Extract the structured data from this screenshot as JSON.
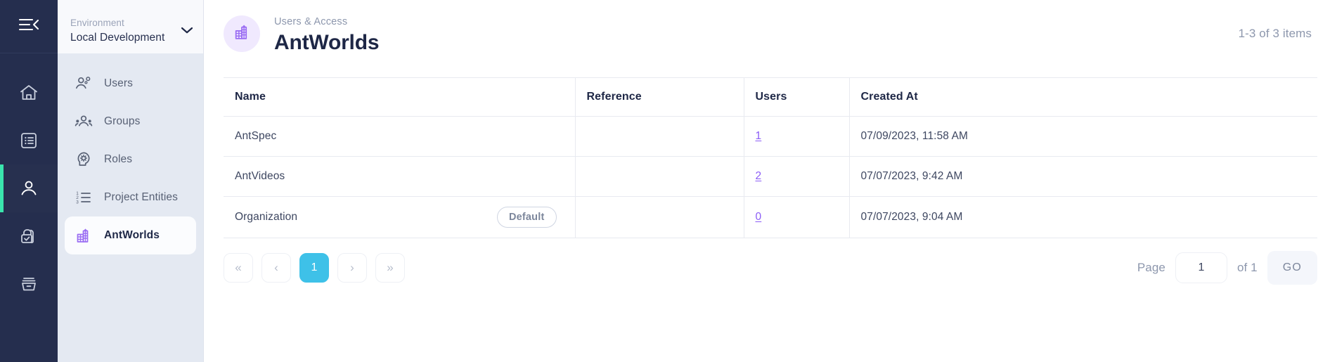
{
  "rail": {
    "collapse_icon": "collapse-menu-icon",
    "items": [
      {
        "icon": "home-icon",
        "name": "home",
        "active": false
      },
      {
        "icon": "list-icon",
        "name": "catalog",
        "active": false
      },
      {
        "icon": "user-icon",
        "name": "users",
        "active": true
      },
      {
        "icon": "lock-check-icon",
        "name": "security",
        "active": false
      },
      {
        "icon": "archive-icon",
        "name": "archive",
        "active": false
      }
    ],
    "active_accent": "#3ae5ad",
    "background": "#252e4e"
  },
  "sidebar": {
    "environment": {
      "label": "Environment",
      "value": "Local Development",
      "chevron_icon": "chevron-down-icon"
    },
    "items": [
      {
        "label": "Users",
        "icon": "user-gear-icon",
        "active": false
      },
      {
        "label": "Groups",
        "icon": "group-icon",
        "active": false
      },
      {
        "label": "Roles",
        "icon": "head-gear-icon",
        "active": false
      },
      {
        "label": "Project Entities",
        "icon": "numbered-list-icon",
        "active": false
      },
      {
        "label": "AntWorlds",
        "icon": "building-icon",
        "active": true
      }
    ],
    "background": "#e4e9f2",
    "active_background": "#fbfcfe",
    "accent": "#9b6ef3"
  },
  "header": {
    "eyebrow": "Users & Access",
    "title": "AntWorlds",
    "badge_icon": "building-icon",
    "item_count": "1-3 of 3 items"
  },
  "table": {
    "columns": [
      "Name",
      "Reference",
      "Users",
      "Created At"
    ],
    "rows": [
      {
        "name": "AntSpec",
        "badge": "",
        "reference": "",
        "users": "1",
        "created_at": "07/09/2023, 11:58 AM"
      },
      {
        "name": "AntVideos",
        "badge": "",
        "reference": "",
        "users": "2",
        "created_at": "07/07/2023, 9:42 AM"
      },
      {
        "name": "Organization",
        "badge": "Default",
        "reference": "",
        "users": "0",
        "created_at": "07/07/2023, 9:04 AM"
      }
    ],
    "link_color": "#8b5cf6"
  },
  "pagination": {
    "first_label": "«",
    "prev_label": "‹",
    "current_page": "1",
    "next_label": "›",
    "last_label": "»",
    "page_label": "Page",
    "page_value": "1",
    "of_label": "of 1",
    "go_label": "GO",
    "active_color": "#3ec1e8"
  }
}
